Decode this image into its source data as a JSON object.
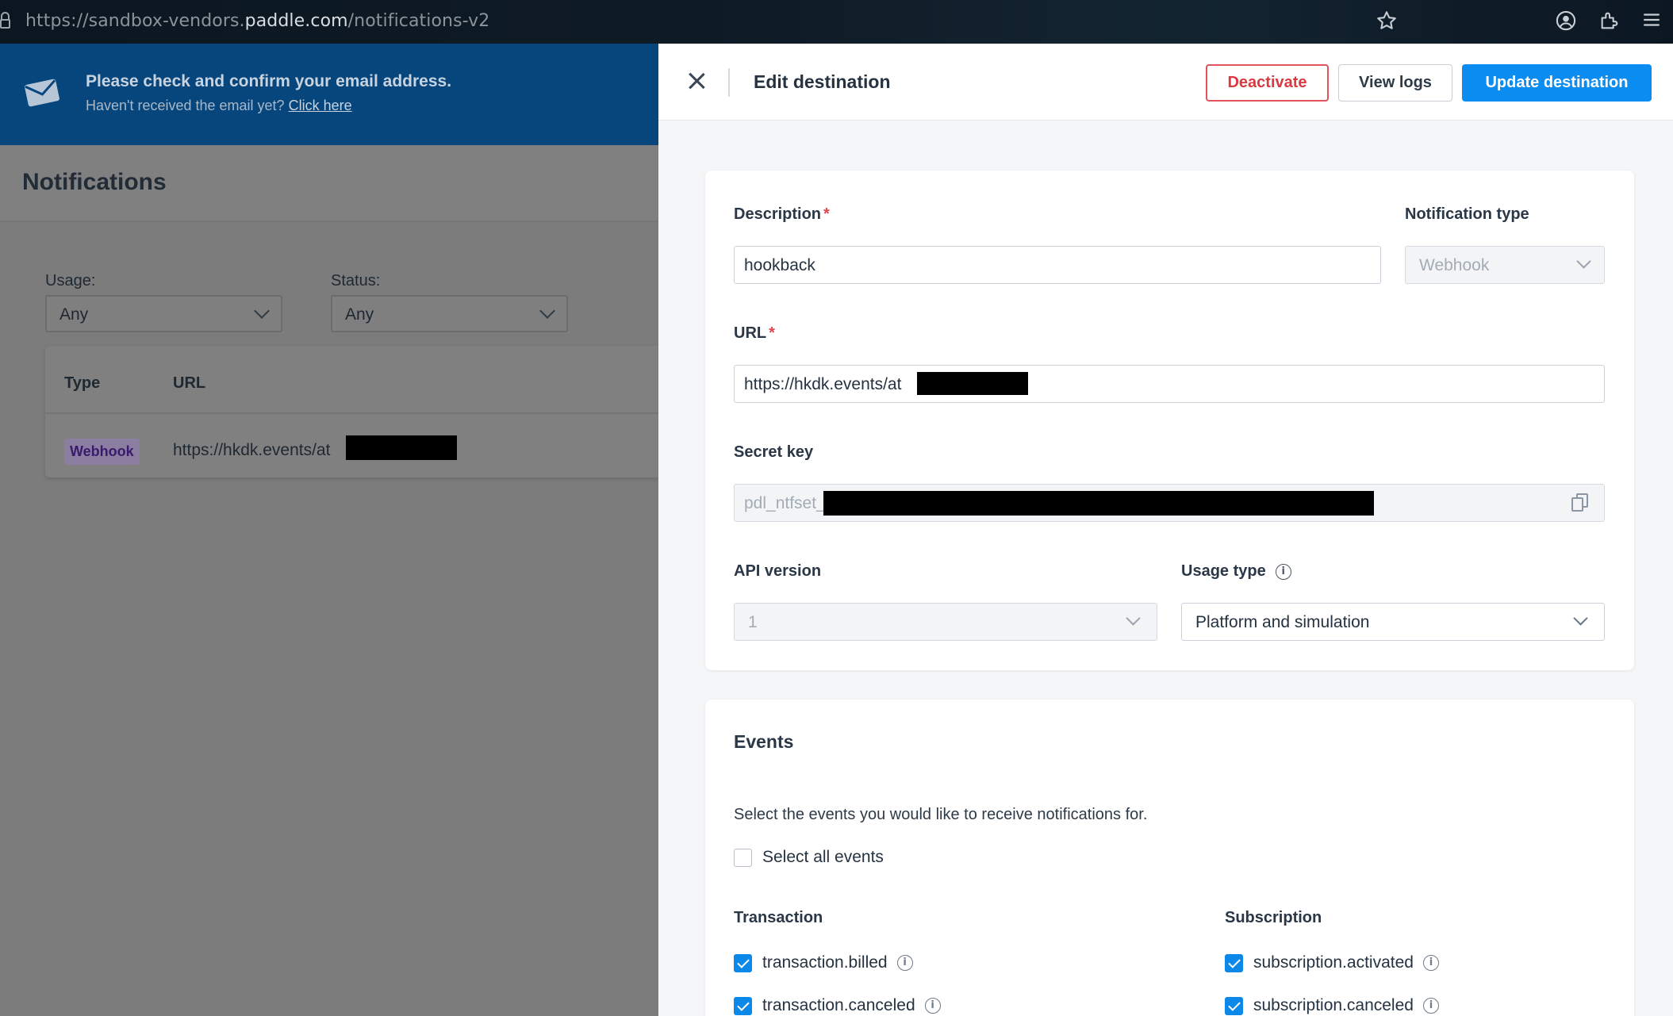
{
  "browser": {
    "url_prefix": "https://sandbox-vendors.",
    "url_host": "paddle.com",
    "url_path": "/notifications-v2",
    "star_icon": "star-icon",
    "account_icon": "account-icon",
    "extensions_icon": "extensions-icon",
    "menu_icon": "menu-icon"
  },
  "banner": {
    "title": "Please check and confirm your email address.",
    "subtitle": "Haven't received the email yet?",
    "link": "Click here"
  },
  "page": {
    "title": "Notifications",
    "filters": {
      "usage_label": "Usage:",
      "usage_value": "Any",
      "status_label": "Status:",
      "status_value": "Any"
    },
    "table": {
      "headers": [
        "Type",
        "URL"
      ],
      "rows": [
        {
          "type": "Webhook",
          "url": "https://hkdk.events/at"
        }
      ]
    }
  },
  "drawer": {
    "title": "Edit destination",
    "actions": {
      "deactivate": "Deactivate",
      "view_logs": "View logs",
      "update": "Update destination"
    },
    "form": {
      "description_label": "Description",
      "description_value": "hookback",
      "required_mark": "*",
      "notification_type_label": "Notification type",
      "notification_type_value": "Webhook",
      "url_label": "URL",
      "url_value": "https://hkdk.events/at",
      "secret_key_label": "Secret key",
      "secret_key_value": "pdl_ntfset_",
      "api_version_label": "API version",
      "api_version_value": "1",
      "usage_type_label": "Usage type",
      "usage_type_value": "Platform and simulation"
    },
    "events": {
      "title": "Events",
      "description": "Select the events you would like to receive notifications for.",
      "select_all_label": "Select all events",
      "groups": {
        "transaction": {
          "title": "Transaction",
          "items": [
            {
              "label": "transaction.billed",
              "checked": true
            },
            {
              "label": "transaction.canceled",
              "checked": true
            }
          ]
        },
        "subscription": {
          "title": "Subscription",
          "items": [
            {
              "label": "subscription.activated",
              "checked": true
            },
            {
              "label": "subscription.canceled",
              "checked": true
            }
          ]
        }
      }
    }
  },
  "colors": {
    "primary": "#0a8cf0",
    "danger": "#d83a41",
    "banner_bg": "#07457d"
  }
}
